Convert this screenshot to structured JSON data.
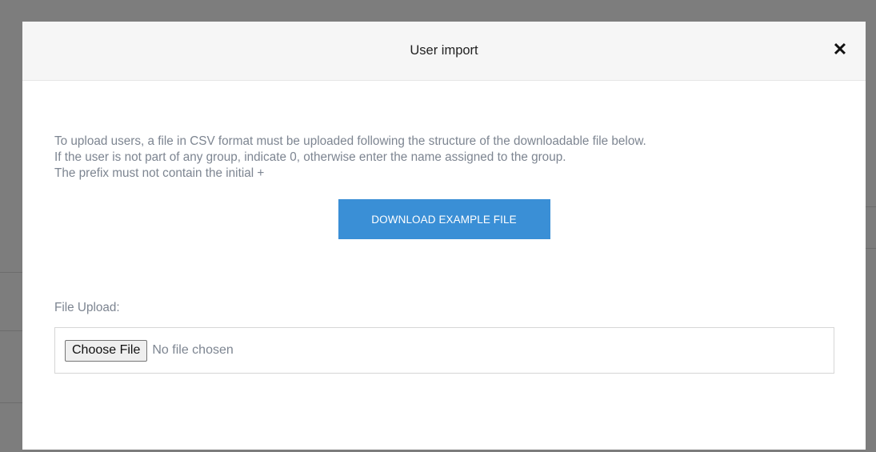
{
  "modal": {
    "title": "User import",
    "close_icon": "close-icon"
  },
  "instructions": {
    "line1": "To upload users, a file in CSV format must be uploaded following the structure of the downloadable file below.",
    "line2": "If the user is not part of any group, indicate 0, otherwise enter the name assigned to the group.",
    "line3": "The prefix must not contain the initial +"
  },
  "download": {
    "label": "DOWNLOAD EXAMPLE FILE"
  },
  "upload": {
    "label": "File Upload:",
    "choose_label": "Choose File",
    "status": "No file chosen"
  },
  "colors": {
    "accent": "#3a8fd6",
    "overlay": "#7d7d7d"
  }
}
